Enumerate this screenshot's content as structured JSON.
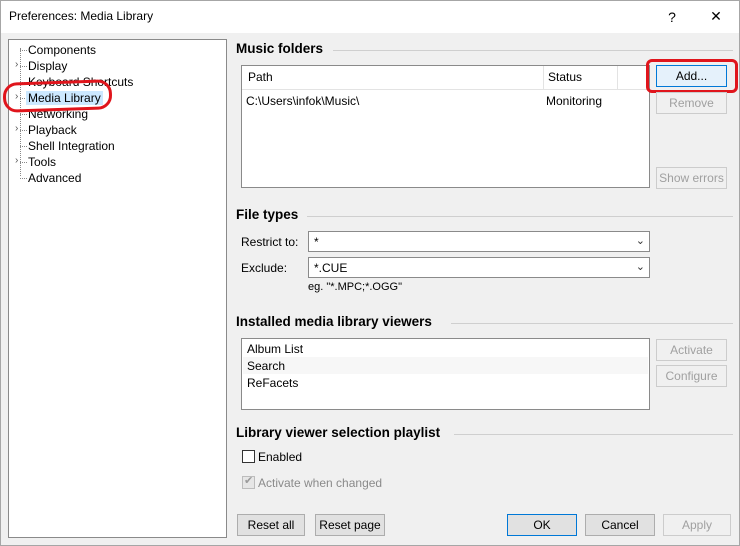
{
  "window": {
    "title": "Preferences: Media Library",
    "help_glyph": "?",
    "close_glyph": "✕"
  },
  "tree": {
    "items": [
      {
        "label": "Components",
        "expandable": false
      },
      {
        "label": "Display",
        "expandable": true
      },
      {
        "label": "Keyboard Shortcuts",
        "expandable": false
      },
      {
        "label": "Media Library",
        "expandable": true,
        "selected": true
      },
      {
        "label": "Networking",
        "expandable": false
      },
      {
        "label": "Playback",
        "expandable": true
      },
      {
        "label": "Shell Integration",
        "expandable": false
      },
      {
        "label": "Tools",
        "expandable": true
      },
      {
        "label": "Advanced",
        "expandable": false
      }
    ]
  },
  "music_folders": {
    "title": "Music folders",
    "columns": [
      "Path",
      "Status"
    ],
    "rows": [
      {
        "path": "C:\\Users\\infok\\Music\\",
        "status": "Monitoring"
      }
    ],
    "add_label": "Add...",
    "remove_label": "Remove",
    "show_errors_label": "Show errors"
  },
  "file_types": {
    "title": "File types",
    "restrict_label": "Restrict to:",
    "restrict_value": "*",
    "exclude_label": "Exclude:",
    "exclude_value": "*.CUE",
    "hint": "eg. \"*.MPC;*.OGG\""
  },
  "viewers": {
    "title": "Installed media library viewers",
    "items": [
      "Album List",
      "Search",
      "ReFacets"
    ],
    "activate_label": "Activate",
    "configure_label": "Configure"
  },
  "playlist": {
    "title": "Library viewer selection playlist",
    "enabled_label": "Enabled",
    "enabled": false,
    "activate_label": "Activate when changed",
    "activate_checked": true
  },
  "footer": {
    "reset_all": "Reset all",
    "reset_page": "Reset page",
    "ok": "OK",
    "cancel": "Cancel",
    "apply": "Apply"
  },
  "colors": {
    "annotation": "#e0151c",
    "selection": "#cce8ff",
    "focus": "#0078d7"
  }
}
